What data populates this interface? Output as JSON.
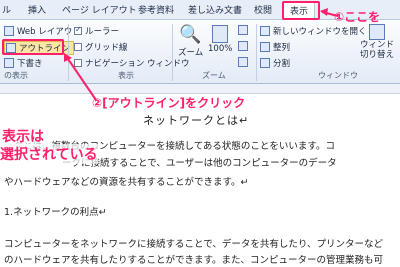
{
  "tabs": [
    "ル",
    "挿入",
    "ページ レイアウト",
    "参考資料",
    "差し込み文書",
    "校閲",
    "表示"
  ],
  "view_group": {
    "web_layout": "Web レイアウト",
    "outline": "アウトライン",
    "draft": "下書き",
    "label": "の表示"
  },
  "show_group": {
    "ruler": "ルーラー",
    "gridlines": "グリッド線",
    "navigation": "ナビゲーション ウィンドウ",
    "label": "表示"
  },
  "zoom_group": {
    "zoom": "ズーム",
    "percent": "100%",
    "label": "ズーム"
  },
  "window_group": {
    "new_window": "新しいウィンドウを開く",
    "arrange": "整列",
    "split": "分割",
    "switch_line1": "ウィンド",
    "switch_line2": "切り替え",
    "label": "ウィンドウ"
  },
  "annotations": {
    "step1": "①ここを",
    "step2": "②[アウトライン]をクリック",
    "note_line1": "表示は",
    "note_line2": "選択されている"
  },
  "document": {
    "title": "ネットワークとは↵",
    "line1": "ークとは、複数台のコンピューターを接続してある状態のことをいいます。コ",
    "line2": "ークに接続することで、ユーザーは他のコンピューターのデータ",
    "line3": "やハードウェアなどの資源を共有することができます。↵",
    "heading": "1.ネットワークの利点↵",
    "line4": "コンピューターをネットワークに接続することで、データを共有したり、プリンターなど",
    "line5": "のハードウェアを共有したりすることができます。また、コンピューターの管理業務も可"
  },
  "colors": {
    "annotation": "#ff1f6b"
  }
}
